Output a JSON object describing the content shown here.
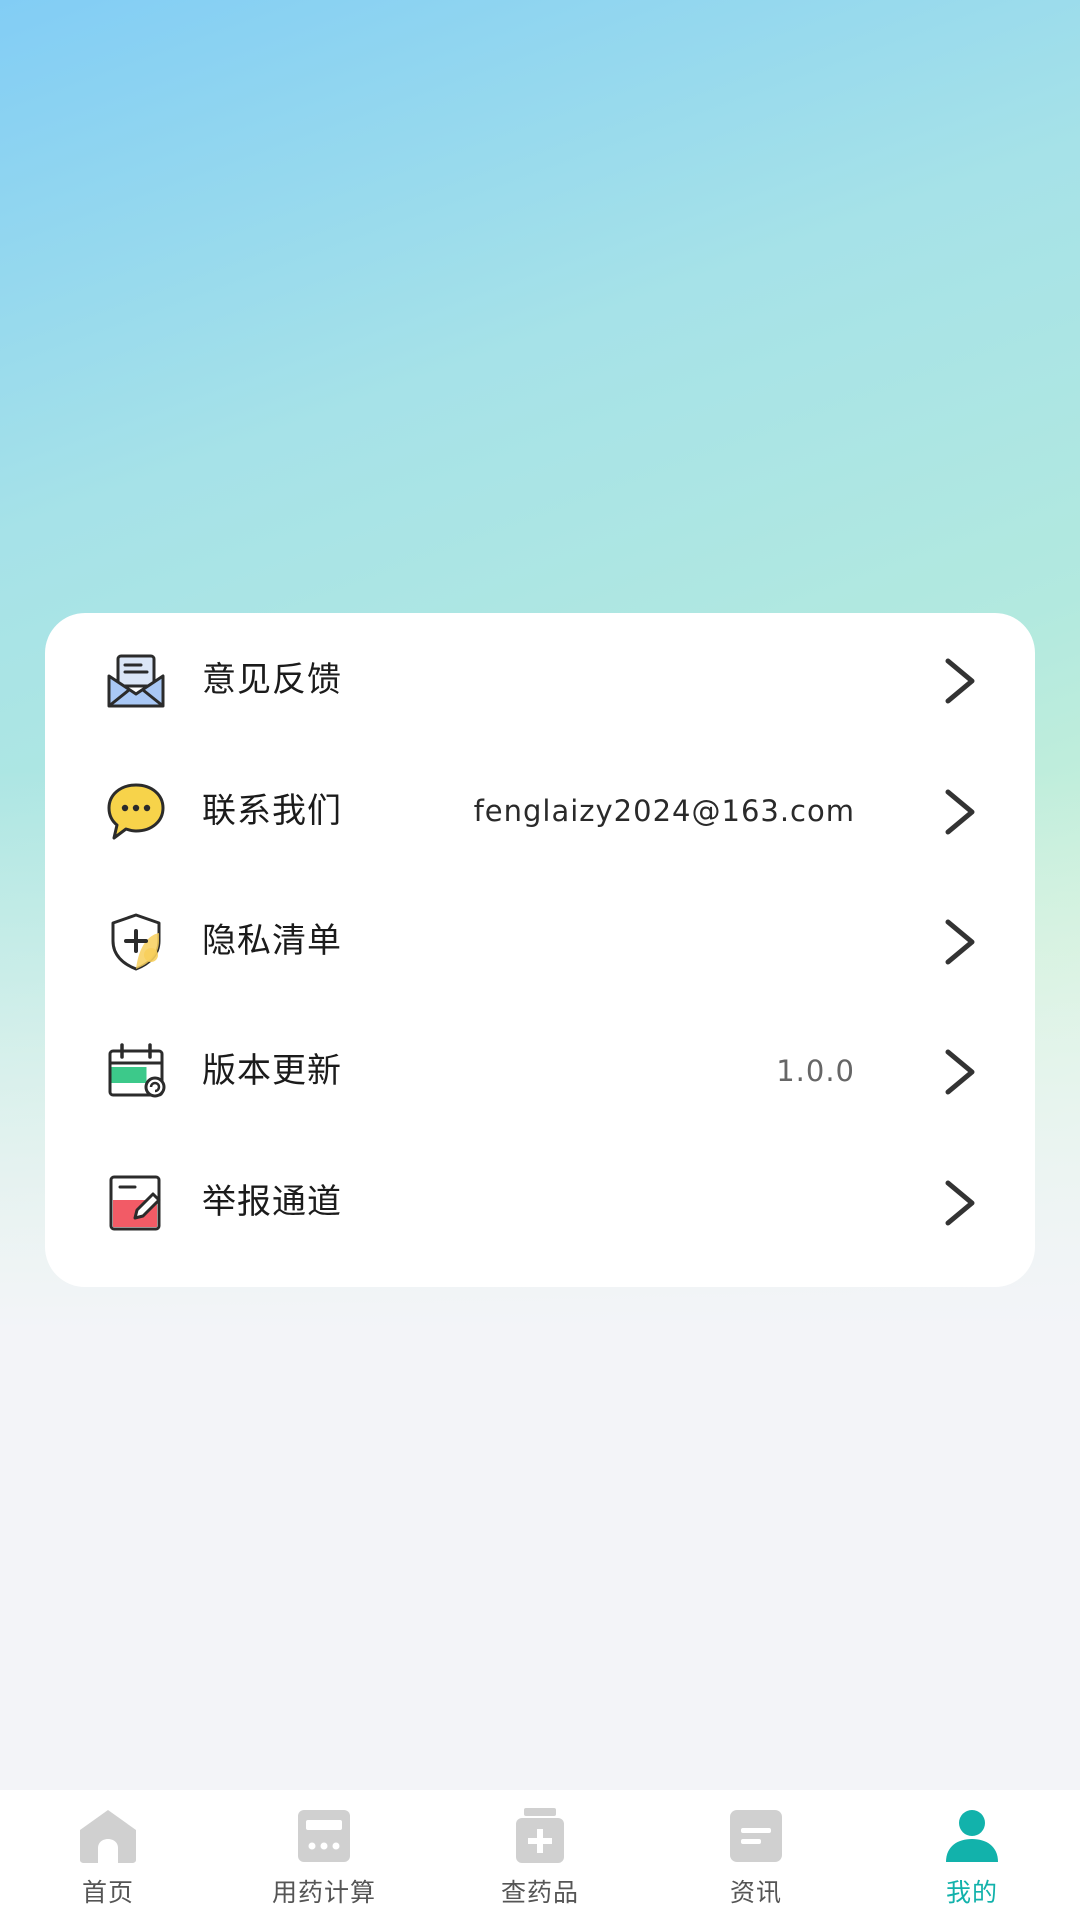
{
  "menu": {
    "items": [
      {
        "label": "意见反馈",
        "value": "",
        "icon": "feedback-envelope-icon"
      },
      {
        "label": "联系我们",
        "value": "fenglaizy2024@163.com",
        "icon": "chat-bubble-icon"
      },
      {
        "label": "隐私清单",
        "value": "",
        "icon": "shield-plus-icon"
      },
      {
        "label": "版本更新",
        "value": "1.0.0",
        "icon": "calendar-refresh-icon"
      },
      {
        "label": "举报通道",
        "value": "",
        "icon": "report-edit-icon"
      }
    ]
  },
  "tabbar": {
    "tabs": [
      {
        "label": "首页",
        "icon": "home-icon",
        "active": false
      },
      {
        "label": "用药计算",
        "icon": "calculator-icon",
        "active": false
      },
      {
        "label": "查药品",
        "icon": "medicine-box-icon",
        "active": false
      },
      {
        "label": "资讯",
        "icon": "news-icon",
        "active": false
      },
      {
        "label": "我的",
        "icon": "user-icon",
        "active": true
      }
    ]
  },
  "colors": {
    "accent": "#12b2ab",
    "inactive_icon": "#cfcfcf",
    "gradient_top": "#82cdf5",
    "gradient_mid": "#b2e9df",
    "gradient_bottom": "#cdf2d8"
  }
}
